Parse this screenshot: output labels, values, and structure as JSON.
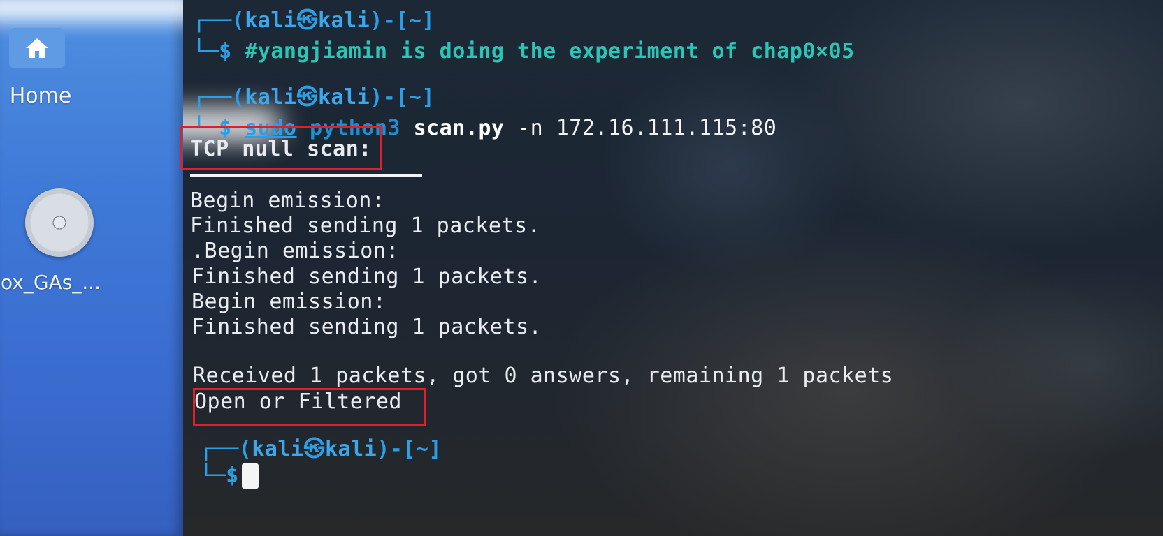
{
  "desktop": {
    "icons": [
      {
        "name": "home",
        "label": "Home",
        "icon": "home-icon"
      },
      {
        "name": "vbox-guest-additions",
        "label": "ox_GAs_...",
        "icon": "disc-icon"
      }
    ]
  },
  "terminal": {
    "prompt1": {
      "top_prefix": "┌──(",
      "user": "kali",
      "at": "㉿",
      "host": "kali",
      "cwd_part": ")-[~]",
      "bottom_prefix": "└─",
      "dollar": "$ ",
      "command": "#yangjiamin is doing the experiment of chap0×05"
    },
    "prompt2": {
      "top_prefix": "┌──(",
      "user": "kali",
      "at": "㉿",
      "host": "kali",
      "cwd_part": ")-[~]",
      "bottom_prefix": "└─",
      "dollar": "$ ",
      "sudo": "sudo",
      "interpreter": " python3 ",
      "script": "scan.py",
      "flag": " -n ",
      "target": "172.16.111.115:80"
    },
    "output": {
      "scan_title": "TCP null scan:",
      "lines": [
        "Begin emission:",
        "Finished sending 1 packets.",
        ".Begin emission:",
        "Finished sending 1 packets.",
        "Begin emission:",
        "Finished sending 1 packets."
      ],
      "received": "Received 1 packets, got 0 answers, remaining 1 packets",
      "result": "Open or Filtered"
    },
    "prompt3": {
      "top_prefix": "┌──(",
      "user": "kali",
      "at": "㉿",
      "host": "kali",
      "cwd_part": ")-[~]",
      "bottom_prefix": "└─",
      "dollar": "$ "
    }
  },
  "colors": {
    "prompt_blue": "#2a9fe6",
    "comment_teal": "#2cc4b4",
    "highlight_red": "#e01f2a",
    "desktop_blue": "#3f7ad8"
  }
}
